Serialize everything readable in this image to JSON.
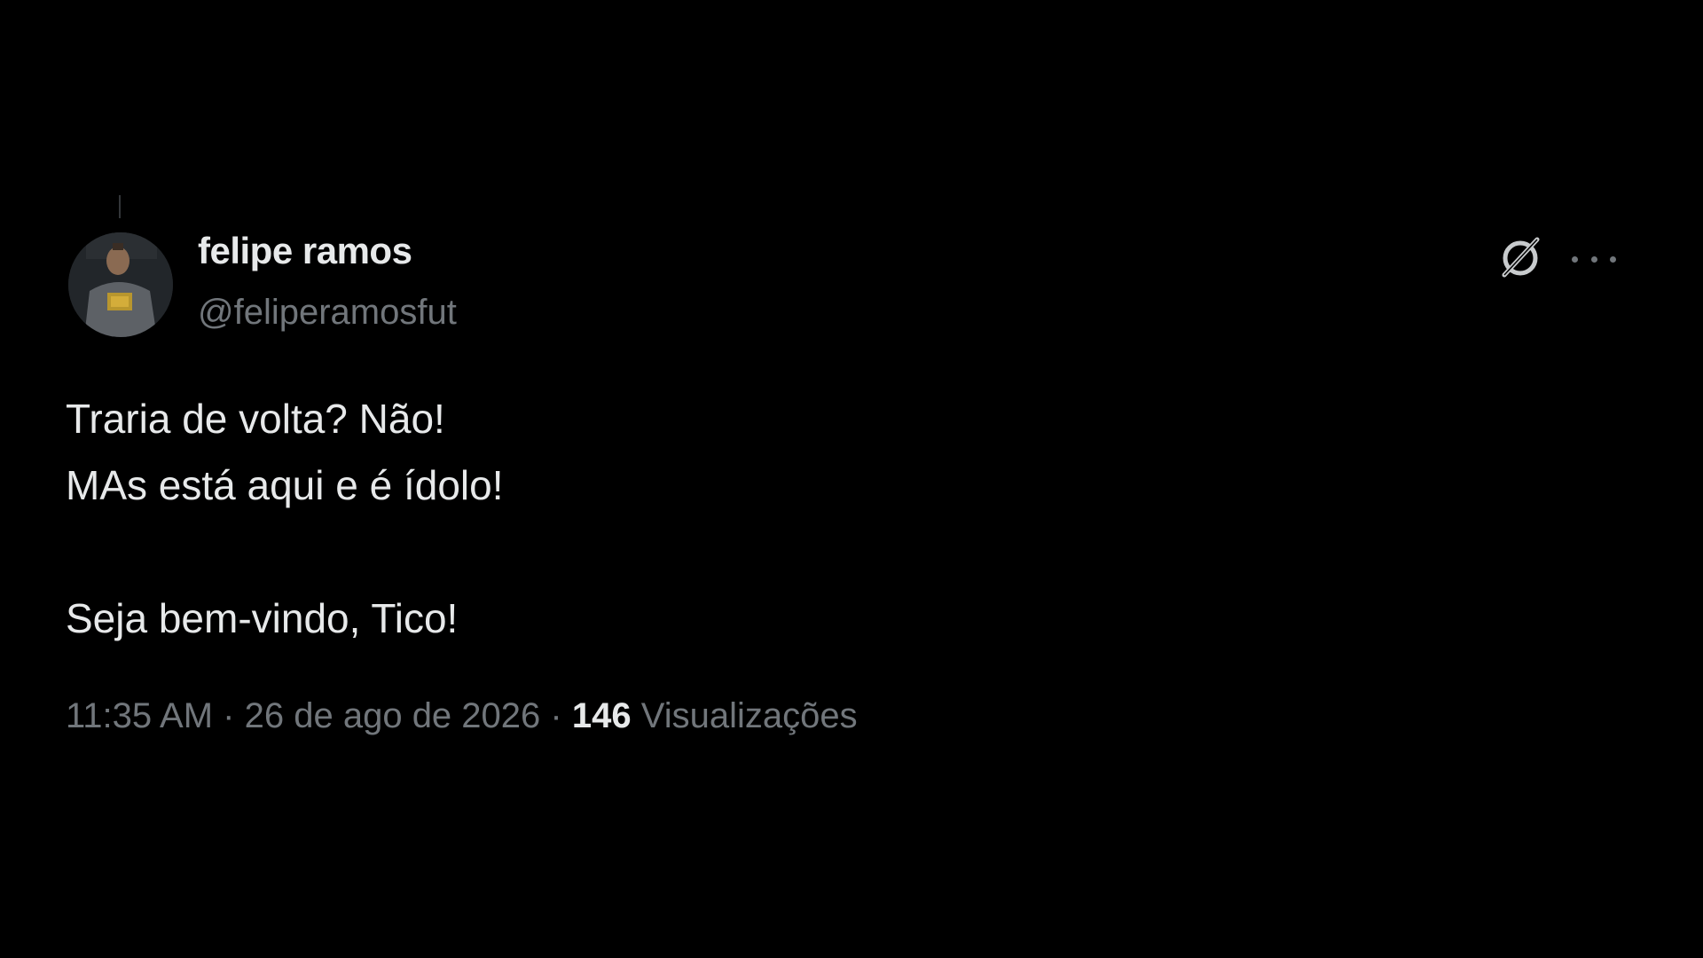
{
  "author": {
    "display_name": "felipe ramos",
    "handle": "@feliperamosfut",
    "avatar_icon": "user-avatar"
  },
  "header_actions": {
    "grok_icon": "grok-icon",
    "more_icon": "more-icon"
  },
  "tweet": {
    "lines": [
      "Traria de volta? Não!",
      "MAs está aqui e é ídolo!",
      "",
      "Seja bem-vindo, Tico!"
    ]
  },
  "meta": {
    "time": "11:35 AM",
    "separator": "·",
    "date": "26 de ago de 2026",
    "views_count": "146",
    "views_label": "Visualizações"
  },
  "colors": {
    "background": "#000000",
    "primary_text": "#e7e9ea",
    "secondary_text": "#71767b"
  }
}
